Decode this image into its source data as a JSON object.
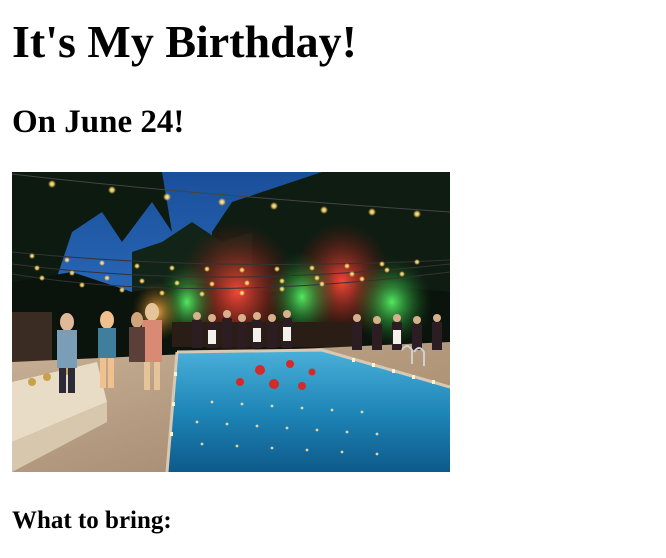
{
  "page": {
    "title": "It's My Birthday!",
    "subtitle": "On June 24!",
    "section_heading": "What to bring:"
  },
  "photo": {
    "subject": "pool-party-photo"
  }
}
